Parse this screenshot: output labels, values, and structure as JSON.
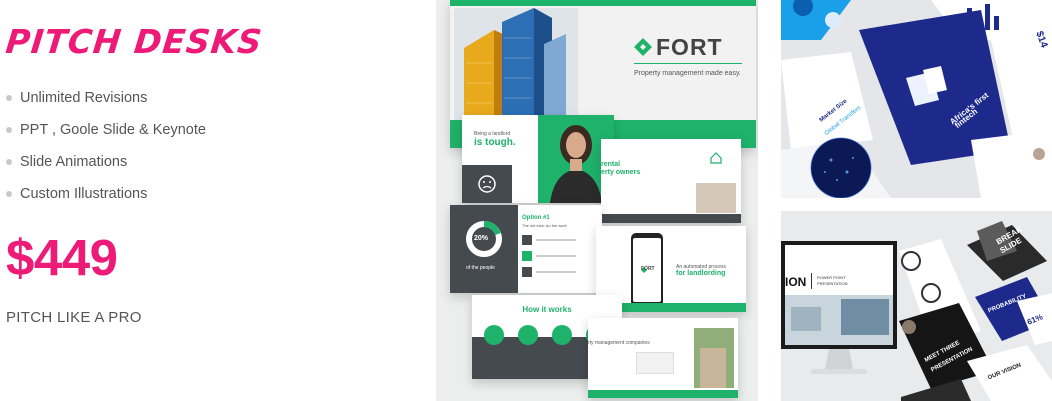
{
  "heading": "PITCH DESKS",
  "features": [
    "Unlimited Revisions",
    "PPT , Goole Slide & Keynote",
    "Slide Animations",
    "Custom Illustrations"
  ],
  "price": "$449",
  "tagline": "PITCH LIKE A PRO",
  "fort": {
    "brand": "FORT",
    "subtitle": "Property management made easy.",
    "landlord_line1": "Being a landlord",
    "landlord_line2": "is tough.",
    "rental_line1": "rental",
    "rental_line2": "erty owners",
    "donut_value": "20%",
    "donut_caption": "of the people",
    "option_title": "Option #1",
    "option_sub": "The old trick: do the work",
    "auto_line1": "An automated process",
    "auto_line2": "for landlording",
    "how_title": "How it works",
    "company_text": "rty management companies"
  },
  "right_top": {
    "stat": "$14",
    "africa_line1": "Africa's first",
    "africa_line2": "fintech",
    "market": "Market Size",
    "market_sub": "Global Transfers"
  },
  "right_bottom": {
    "ion": "ION",
    "monitor_text1": "POWER POINT",
    "monitor_text2": "PRESENTATION",
    "break_text1": "BREAK",
    "break_text2": "SLIDE",
    "probability": "PROBABILITY",
    "percent": "61%",
    "meet1": "MEET THREE",
    "meet2": "PRESENTATION",
    "our_vision": "OUR VISION"
  },
  "colors": {
    "accent": "#ee1a78",
    "fort_green": "#1fb26b",
    "navy": "#1d2a8c"
  }
}
